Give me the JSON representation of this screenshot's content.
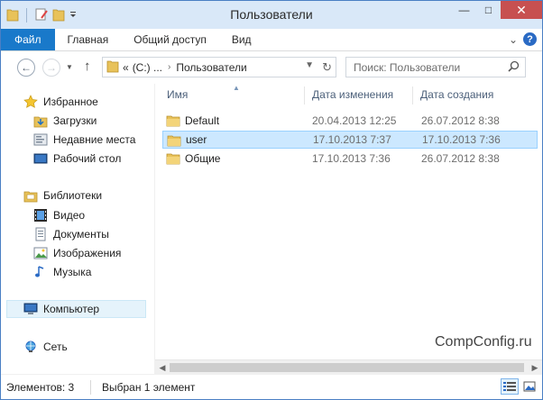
{
  "window": {
    "title": "Пользователи",
    "controls": {
      "minimize": "—",
      "maximize": "□",
      "close": "✕"
    }
  },
  "ribbon": {
    "tabs": [
      "Файл",
      "Главная",
      "Общий доступ",
      "Вид"
    ],
    "collapse": "⌄",
    "help": "?"
  },
  "nav": {
    "back": "←",
    "forward": "→",
    "up": "↑",
    "address": {
      "prefix": "«",
      "drive": "(C:) ...",
      "separator": "›",
      "current": "Пользователи"
    },
    "search_placeholder": "Поиск: Пользователи"
  },
  "sidebar": {
    "favorites": {
      "label": "Избранное",
      "items": [
        "Загрузки",
        "Недавние места",
        "Рабочий стол"
      ]
    },
    "libraries": {
      "label": "Библиотеки",
      "items": [
        "Видео",
        "Документы",
        "Изображения",
        "Музыка"
      ]
    },
    "computer": "Компьютер",
    "network": "Сеть"
  },
  "content": {
    "columns": [
      "Имя",
      "Дата изменения",
      "Дата создания"
    ],
    "rows": [
      {
        "name": "Default",
        "modified": "20.04.2013 12:25",
        "created": "26.07.2012 8:38",
        "selected": false
      },
      {
        "name": "user",
        "modified": "17.10.2013 7:37",
        "created": "17.10.2013 7:36",
        "selected": true
      },
      {
        "name": "Общие",
        "modified": "17.10.2013 7:36",
        "created": "26.07.2012 8:38",
        "selected": false
      }
    ]
  },
  "watermark": "CompConfig.ru",
  "status": {
    "count": "Элементов: 3",
    "selection": "Выбран 1 элемент"
  },
  "colors": {
    "file_tab": "#1979ca",
    "selection": "#cce8ff",
    "titlebar": "#d9e8f8",
    "close_button": "#c75050",
    "folder": "#e8c25a"
  }
}
